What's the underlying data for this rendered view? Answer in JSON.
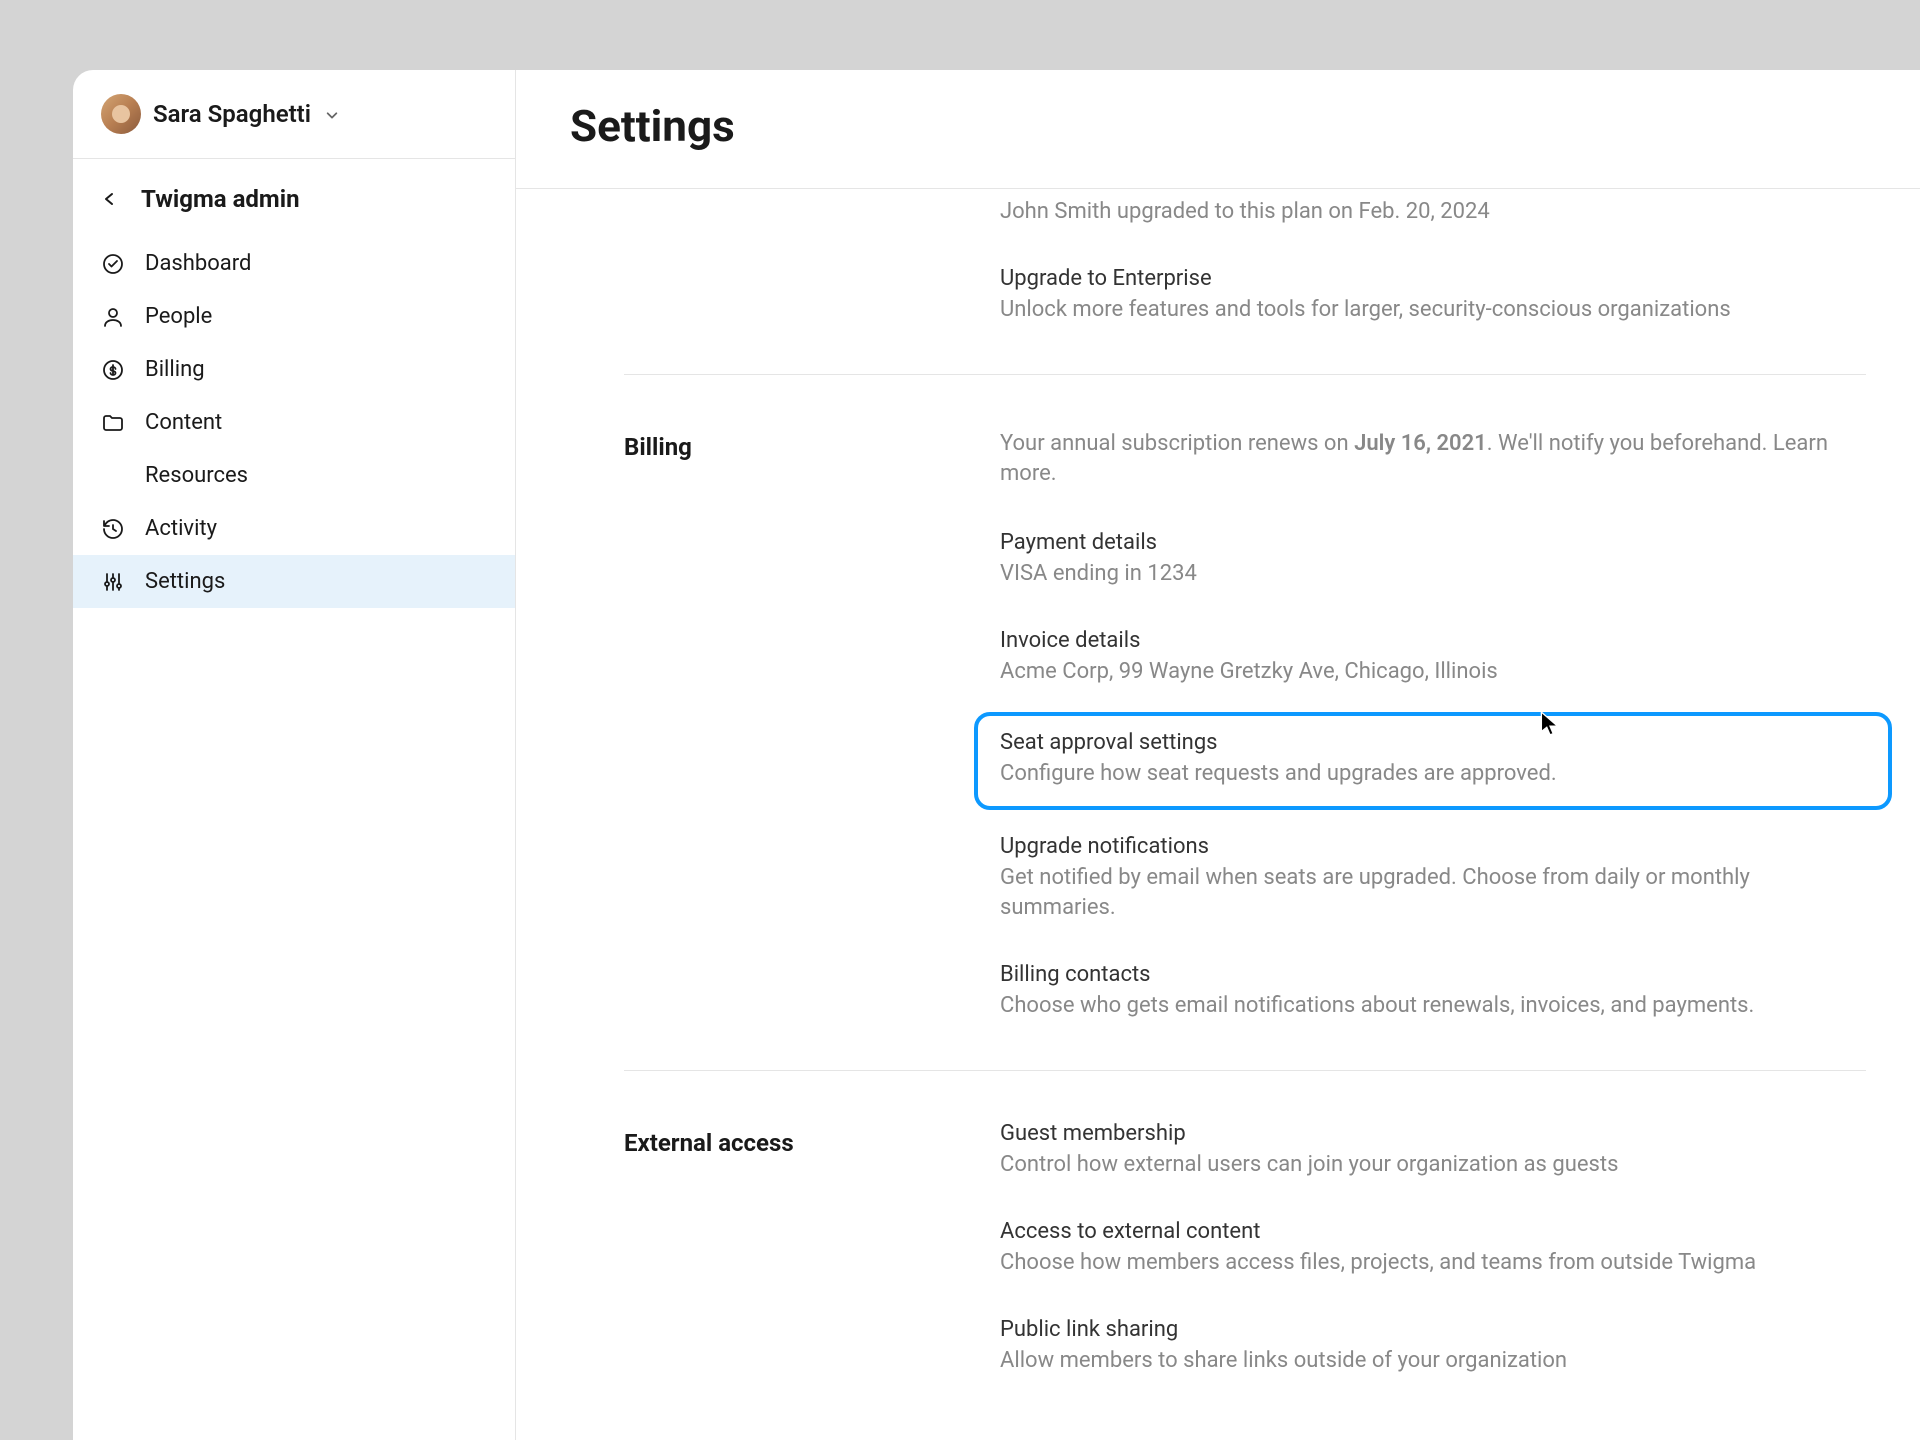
{
  "user": {
    "name": "Sara Spaghetti"
  },
  "workspace": {
    "name": "Twigma admin"
  },
  "nav": {
    "dashboard": "Dashboard",
    "people": "People",
    "billing": "Billing",
    "content": "Content",
    "resources": "Resources",
    "activity": "Activity",
    "settings": "Settings"
  },
  "page": {
    "title": "Settings"
  },
  "plan": {
    "upgrade_info": "John Smith upgraded to this plan on Feb. 20, 2024",
    "enterprise_title": "Upgrade to Enterprise",
    "enterprise_desc": "Unlock more features and tools for larger, security-conscious organizations"
  },
  "billing": {
    "section_label": "Billing",
    "renewal_prefix": "Your annual subscription renews on ",
    "renewal_date": "July 16, 2021",
    "renewal_suffix": ". We'll notify you beforehand. Learn more.",
    "payment_title": "Payment details",
    "payment_desc": "VISA ending in 1234",
    "invoice_title": "Invoice details",
    "invoice_desc": "Acme Corp, 99 Wayne Gretzky Ave, Chicago, Illinois",
    "seat_title": "Seat approval settings",
    "seat_desc": "Configure how seat requests and upgrades are approved.",
    "upgrade_notif_title": "Upgrade notifications",
    "upgrade_notif_desc": "Get notified by email when seats are upgraded. Choose from daily or monthly summaries.",
    "contacts_title": "Billing contacts",
    "contacts_desc": "Choose who gets email notifications about renewals, invoices, and payments."
  },
  "external": {
    "section_label": "External access",
    "guest_title": "Guest membership",
    "guest_desc": "Control how external users can join your organization as guests",
    "access_title": "Access to external content",
    "access_desc": "Choose how members access files, projects, and teams from outside Twigma",
    "link_title": "Public link sharing",
    "link_desc": "Allow members to share links outside of your organization"
  }
}
